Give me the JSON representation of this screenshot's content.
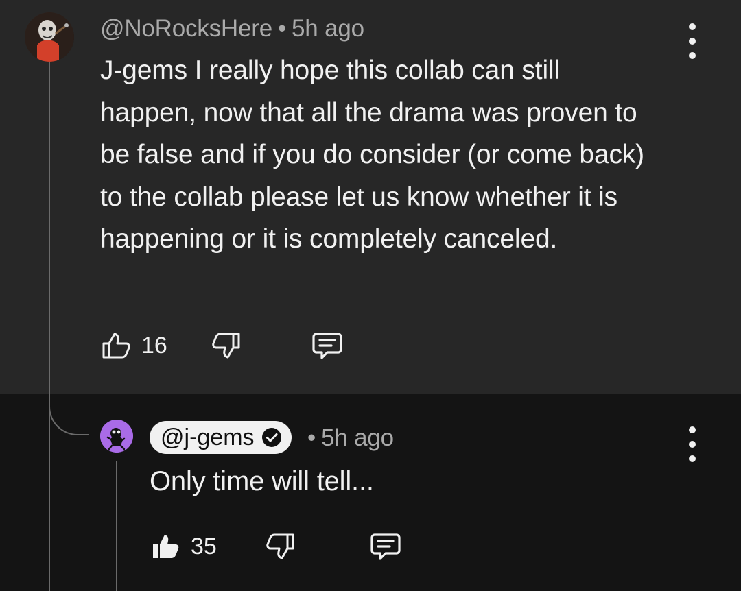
{
  "main_comment": {
    "author": "@NoRocksHere",
    "separator": "•",
    "time": "5h ago",
    "text": "J-gems I really hope this collab can still happen, now that all the drama was proven to be false and if you do consider (or come back) to the collab please let us know whether it is happening or it is completely canceled.",
    "likes": "16",
    "icons": {
      "like": "thumb-up-outline-icon",
      "dislike": "thumb-down-outline-icon",
      "reply": "comment-icon",
      "menu": "more-vertical-icon"
    }
  },
  "reply_comment": {
    "author": "@j-gems",
    "separator": "•",
    "time": "5h ago",
    "text": "Only time will tell...",
    "likes": "35",
    "verified": true,
    "icons": {
      "like": "thumb-up-filled-icon",
      "dislike": "thumb-down-outline-icon",
      "reply": "comment-icon",
      "menu": "more-vertical-icon",
      "verified": "verified-check-icon"
    }
  },
  "colors": {
    "top_background": "#272727",
    "reply_background": "#141414",
    "text_primary": "#f1f1f1",
    "text_secondary": "#aaaaaa",
    "thread_line": "#6a6a6a",
    "reply_avatar": "#a96be7"
  }
}
